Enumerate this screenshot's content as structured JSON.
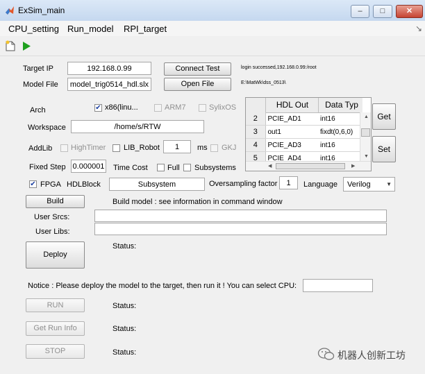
{
  "window": {
    "title": "ExSim_main",
    "minimize": "–",
    "maximize": "□",
    "close": "✕"
  },
  "menu": [
    "CPU_setting",
    "Run_model",
    "RPI_target"
  ],
  "target_ip": {
    "label": "Target IP",
    "value": "192.168.0.99",
    "button": "Connect Test",
    "status": "login successed,192.168.0.99:/root"
  },
  "model_file": {
    "label": "Model File",
    "value": "model_trig0514_hdl.slx",
    "button": "Open File",
    "path": "E:\\MatWk\\dss_0513\\"
  },
  "arch": {
    "label": "Arch",
    "x86": "x86(linu...",
    "arm7": "ARM7",
    "sylix": "SylixOS"
  },
  "workspace": {
    "label": "Workspace",
    "value": "/home/s/RTW"
  },
  "addlib": {
    "label": "AddLib",
    "hightimer": "HighTimer",
    "lib_robot": "LIB_Robot",
    "ms_value": "1",
    "ms_label": "ms",
    "gkj": "GKJ"
  },
  "fixed_step": {
    "label": "Fixed Step",
    "value": "0.000001",
    "time_cost": "Time Cost",
    "full": "Full",
    "subsystems": "Subsystems"
  },
  "fpga": {
    "label": "FPGA",
    "hdlblock_label": "HDLBlock",
    "hdlblock_value": "Subsystem",
    "oversampling_label": "Oversampling factor",
    "oversampling_value": "1",
    "language_label": "Language",
    "language_value": "Verilog"
  },
  "hdl_table": {
    "headers": [
      "HDL Out",
      "Data Typ"
    ],
    "rows": [
      {
        "num": "2",
        "name": "PCIE_AD1",
        "type": "int16"
      },
      {
        "num": "3",
        "name": "out1",
        "type": "fixdt(0,6,0)"
      },
      {
        "num": "4",
        "name": "PCIE_AD3",
        "type": "int16"
      },
      {
        "num": "5",
        "name": "PCIE_AD4",
        "type": "int16"
      }
    ],
    "get_button": "Get",
    "set_button": "Set"
  },
  "build": {
    "button": "Build",
    "info": "Build model : see information in command window",
    "user_srcs_label": "User Srcs:",
    "user_libs_label": "User Libs:"
  },
  "deploy": {
    "button": "Deploy",
    "status": "Status:"
  },
  "notice": "Notice : Please deploy the model to the target, then run it ! You can select CPU:",
  "run": {
    "button": "RUN",
    "status": "Status:"
  },
  "get_run_info": {
    "button": "Get Run Info",
    "status": "Status:"
  },
  "stop": {
    "button": "STOP",
    "status": "Status:"
  },
  "watermark": "机器人创新工坊",
  "colors": {
    "run_icon": "#1fa01f",
    "title_bar": "#c5d8ef",
    "close_button": "#c64332"
  }
}
